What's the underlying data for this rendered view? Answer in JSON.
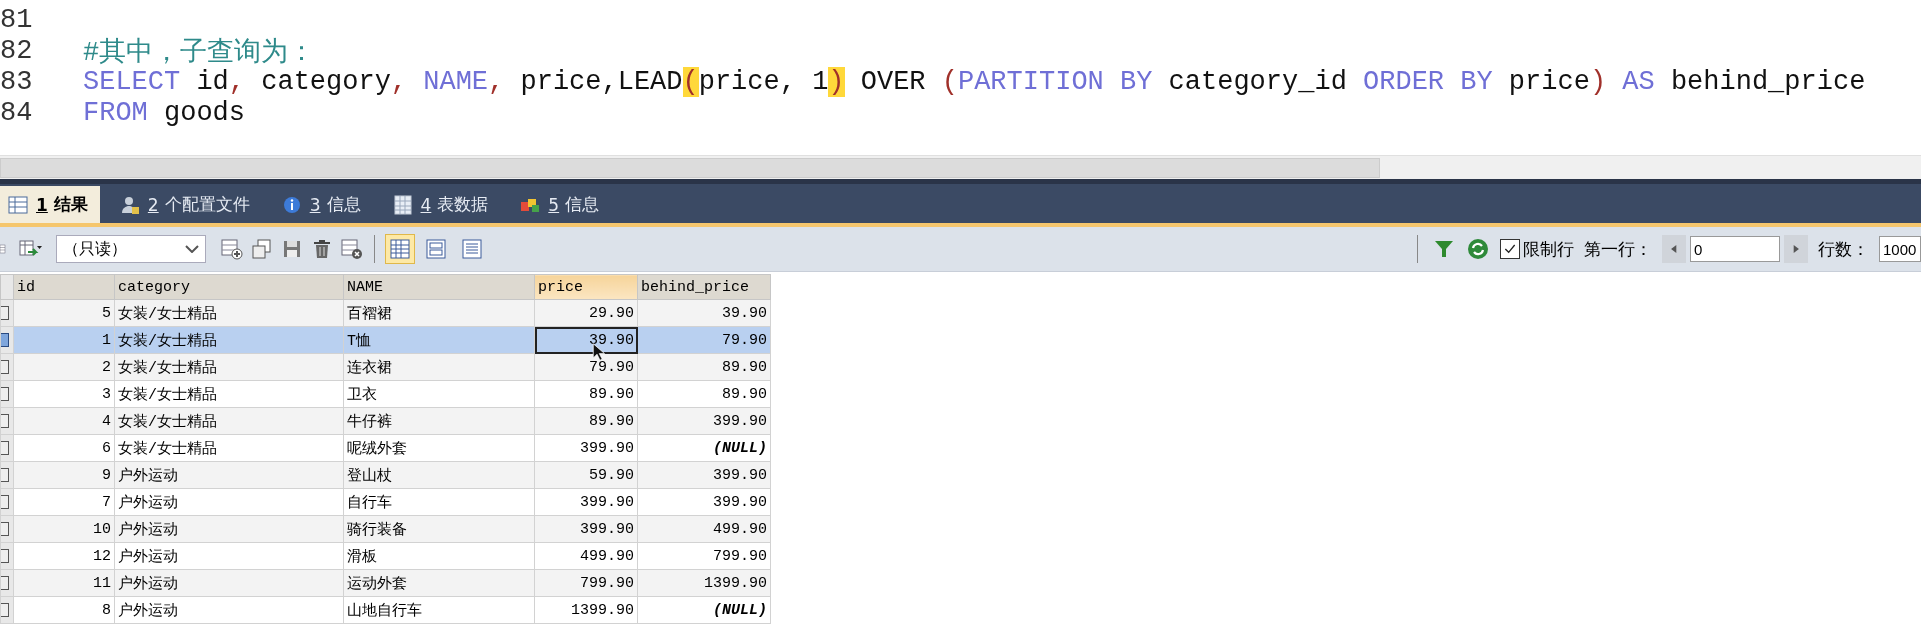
{
  "editor": {
    "lines": [
      {
        "number": "81"
      },
      {
        "number": "82",
        "tokens": [
          {
            "text": "#其中，子查询为：",
            "kind": "comment"
          }
        ]
      },
      {
        "number": "83",
        "tokens": [
          {
            "text": "SELECT",
            "kind": "keyword"
          },
          {
            "text": " id",
            "kind": "plain"
          },
          {
            "text": ",",
            "kind": "punct"
          },
          {
            "text": " category",
            "kind": "plain"
          },
          {
            "text": ",",
            "kind": "punct"
          },
          {
            "text": " NAME",
            "kind": "keyword"
          },
          {
            "text": ",",
            "kind": "punct"
          },
          {
            "text": " price,LEAD",
            "kind": "plain"
          },
          {
            "text": "(",
            "kind": "match"
          },
          {
            "text": "price, 1",
            "kind": "plain"
          },
          {
            "text": ")",
            "kind": "match"
          },
          {
            "text": " OVER ",
            "kind": "plain"
          },
          {
            "text": "(",
            "kind": "punct"
          },
          {
            "text": "PARTITION BY",
            "kind": "keyword"
          },
          {
            "text": " category_id ",
            "kind": "plain"
          },
          {
            "text": "ORDER BY",
            "kind": "keyword"
          },
          {
            "text": " price",
            "kind": "plain"
          },
          {
            "text": ")",
            "kind": "punct"
          },
          {
            "text": " AS",
            "kind": "keyword"
          },
          {
            "text": " behind_price",
            "kind": "plain"
          }
        ]
      },
      {
        "number": "84",
        "tokens": [
          {
            "text": "FROM",
            "kind": "keyword"
          },
          {
            "text": " goods",
            "kind": "plain"
          }
        ]
      }
    ]
  },
  "result_tabs": [
    {
      "number": "1",
      "label": "结果",
      "selected": true
    },
    {
      "number": "2",
      "label": "个配置文件",
      "selected": false
    },
    {
      "number": "3",
      "label": "信息",
      "selected": false
    },
    {
      "number": "4",
      "label": "表数据",
      "selected": false
    },
    {
      "number": "5",
      "label": "信息",
      "selected": false
    }
  ],
  "toolbar": {
    "mode": "（只读）",
    "limit_rows": {
      "label": "限制行",
      "checked": true
    },
    "first_row": {
      "label": "第一行：",
      "value": "0"
    },
    "row_count": {
      "label": "行数：",
      "value": "1000"
    }
  },
  "table": {
    "columns": [
      {
        "label": "id",
        "kind": "number",
        "highlighted": false
      },
      {
        "label": "category",
        "kind": "text",
        "highlighted": false
      },
      {
        "label": "NAME",
        "kind": "text",
        "highlighted": false
      },
      {
        "label": "price",
        "kind": "number",
        "highlighted": true
      },
      {
        "label": "behind_price",
        "kind": "number",
        "highlighted": false
      }
    ],
    "rows": [
      {
        "selected": false,
        "cells": [
          {
            "text": "5",
            "focused": false,
            "null": false
          },
          {
            "text": "女装/女士精品",
            "focused": false,
            "null": false
          },
          {
            "text": "百褶裙",
            "focused": false,
            "null": false
          },
          {
            "text": "29.90",
            "focused": false,
            "null": false
          },
          {
            "text": "39.90",
            "focused": false,
            "null": false
          }
        ]
      },
      {
        "selected": true,
        "cells": [
          {
            "text": "1",
            "focused": false,
            "null": false
          },
          {
            "text": "女装/女士精品",
            "focused": false,
            "null": false
          },
          {
            "text": "T恤",
            "focused": false,
            "null": false
          },
          {
            "text": "39.90",
            "focused": true,
            "null": false
          },
          {
            "text": "79.90",
            "focused": false,
            "null": false
          }
        ]
      },
      {
        "selected": false,
        "cells": [
          {
            "text": "2",
            "focused": false,
            "null": false
          },
          {
            "text": "女装/女士精品",
            "focused": false,
            "null": false
          },
          {
            "text": "连衣裙",
            "focused": false,
            "null": false
          },
          {
            "text": "79.90",
            "focused": false,
            "null": false
          },
          {
            "text": "89.90",
            "focused": false,
            "null": false
          }
        ]
      },
      {
        "selected": false,
        "cells": [
          {
            "text": "3",
            "focused": false,
            "null": false
          },
          {
            "text": "女装/女士精品",
            "focused": false,
            "null": false
          },
          {
            "text": "卫衣",
            "focused": false,
            "null": false
          },
          {
            "text": "89.90",
            "focused": false,
            "null": false
          },
          {
            "text": "89.90",
            "focused": false,
            "null": false
          }
        ]
      },
      {
        "selected": false,
        "cells": [
          {
            "text": "4",
            "focused": false,
            "null": false
          },
          {
            "text": "女装/女士精品",
            "focused": false,
            "null": false
          },
          {
            "text": "牛仔裤",
            "focused": false,
            "null": false
          },
          {
            "text": "89.90",
            "focused": false,
            "null": false
          },
          {
            "text": "399.90",
            "focused": false,
            "null": false
          }
        ]
      },
      {
        "selected": false,
        "cells": [
          {
            "text": "6",
            "focused": false,
            "null": false
          },
          {
            "text": "女装/女士精品",
            "focused": false,
            "null": false
          },
          {
            "text": "呢绒外套",
            "focused": false,
            "null": false
          },
          {
            "text": "399.90",
            "focused": false,
            "null": false
          },
          {
            "text": "(NULL)",
            "focused": false,
            "null": true
          }
        ]
      },
      {
        "selected": false,
        "cells": [
          {
            "text": "9",
            "focused": false,
            "null": false
          },
          {
            "text": "户外运动",
            "focused": false,
            "null": false
          },
          {
            "text": "登山杖",
            "focused": false,
            "null": false
          },
          {
            "text": "59.90",
            "focused": false,
            "null": false
          },
          {
            "text": "399.90",
            "focused": false,
            "null": false
          }
        ]
      },
      {
        "selected": false,
        "cells": [
          {
            "text": "7",
            "focused": false,
            "null": false
          },
          {
            "text": "户外运动",
            "focused": false,
            "null": false
          },
          {
            "text": "自行车",
            "focused": false,
            "null": false
          },
          {
            "text": "399.90",
            "focused": false,
            "null": false
          },
          {
            "text": "399.90",
            "focused": false,
            "null": false
          }
        ]
      },
      {
        "selected": false,
        "cells": [
          {
            "text": "10",
            "focused": false,
            "null": false
          },
          {
            "text": "户外运动",
            "focused": false,
            "null": false
          },
          {
            "text": "骑行装备",
            "focused": false,
            "null": false
          },
          {
            "text": "399.90",
            "focused": false,
            "null": false
          },
          {
            "text": "499.90",
            "focused": false,
            "null": false
          }
        ]
      },
      {
        "selected": false,
        "cells": [
          {
            "text": "12",
            "focused": false,
            "null": false
          },
          {
            "text": "户外运动",
            "focused": false,
            "null": false
          },
          {
            "text": "滑板",
            "focused": false,
            "null": false
          },
          {
            "text": "499.90",
            "focused": false,
            "null": false
          },
          {
            "text": "799.90",
            "focused": false,
            "null": false
          }
        ]
      },
      {
        "selected": false,
        "cells": [
          {
            "text": "11",
            "focused": false,
            "null": false
          },
          {
            "text": "户外运动",
            "focused": false,
            "null": false
          },
          {
            "text": "运动外套",
            "focused": false,
            "null": false
          },
          {
            "text": "799.90",
            "focused": false,
            "null": false
          },
          {
            "text": "1399.90",
            "focused": false,
            "null": false
          }
        ]
      },
      {
        "selected": false,
        "cells": [
          {
            "text": "8",
            "focused": false,
            "null": false
          },
          {
            "text": "户外运动",
            "focused": false,
            "null": false
          },
          {
            "text": "山地自行车",
            "focused": false,
            "null": false
          },
          {
            "text": "1399.90",
            "focused": false,
            "null": false
          },
          {
            "text": "(NULL)",
            "focused": false,
            "null": true
          }
        ]
      }
    ]
  }
}
